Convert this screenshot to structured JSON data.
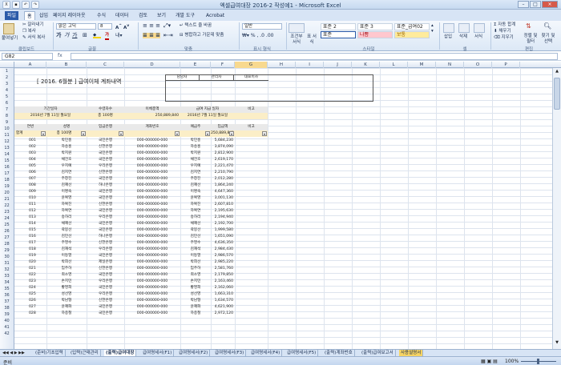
{
  "window": {
    "title": "엑셀급여대장 2016-2 작성예1 - Microsoft Excel",
    "minimize": "–",
    "maximize": "□",
    "close": "×"
  },
  "ribbon_tabs": [
    "파일",
    "홈",
    "삽입",
    "페이지 레이아웃",
    "수식",
    "데이터",
    "검토",
    "보기",
    "개발 도구",
    "Acrobat"
  ],
  "ribbon": {
    "paste": "붙여넣기",
    "cut": "잘라내기",
    "copy": "복사",
    "format_painter": "서식 복사",
    "font_name": "맑은 고딕",
    "font_size": "8",
    "wrap_text": "텍스트 줄 바꿈",
    "merge_center": "병합하고 가운데 맞춤",
    "number_format": "일반",
    "cond_format": "조건부 서식",
    "table_format": "표 서식",
    "styles": [
      "표준 2",
      "표준 3",
      "표준_급여02",
      "표준",
      "나쁨",
      "보통"
    ],
    "insert": "삽입",
    "delete": "삭제",
    "format": "서식",
    "autosum": "자동 합계",
    "fill": "채우기",
    "clear": "지우기",
    "sort_filter": "정렬 및 필터",
    "find_select": "찾기 및 선택",
    "groups": [
      "클립보드",
      "글꼴",
      "맞춤",
      "표시 형식",
      "스타일",
      "셀",
      "편집"
    ]
  },
  "name_box": "G82",
  "fx": "fx",
  "columns": [
    "A",
    "B",
    "C",
    "D",
    "E",
    "F",
    "G",
    "H",
    "I",
    "J",
    "K",
    "L",
    "M",
    "N",
    "O",
    "P"
  ],
  "rows": [
    "1",
    "2",
    "3",
    "4",
    "5",
    "6",
    "7",
    "8",
    "9",
    "10",
    "11",
    "12",
    "13",
    "14",
    "15",
    "16",
    "17",
    "18",
    "19",
    "20",
    "21",
    "22",
    "23",
    "24",
    "25",
    "26",
    "27",
    "28",
    "29",
    "30",
    "31",
    "32",
    "33",
    "34",
    "35",
    "36",
    "37",
    "38",
    "39",
    "40",
    "41",
    "42"
  ],
  "sheet": {
    "title": "[ 2016. 6월분 ] 급여이체 계좌내역",
    "approval": [
      "담당자",
      "관리자",
      "대표이사"
    ],
    "summary_headers": [
      "기간일자",
      "수령자수",
      "이체총액",
      "급여 지급 일자",
      "비고"
    ],
    "summary_values": [
      "2016년 7월 11일 월요일",
      "총 100명",
      "250,889,840",
      "2016년 7월 11일 월요일",
      ""
    ],
    "table_headers": [
      "연번",
      "성명",
      "입금은행",
      "계좌번호",
      "예금주",
      "입금액",
      "비고"
    ],
    "filter_row": [
      "합계",
      "총 100명",
      "",
      "",
      "",
      "250,889,840",
      ""
    ],
    "records": [
      [
        "001",
        "박민홍",
        "국민은행",
        "000-000000-000",
        "박민홍",
        "5,684,230"
      ],
      [
        "002",
        "차송홍",
        "신한은행",
        "000-000000-000",
        "차송홍",
        "3,874,090"
      ],
      [
        "003",
        "박지원",
        "국민은행",
        "000-000000-000",
        "박지원",
        "2,812,900"
      ],
      [
        "004",
        "채건호",
        "국민은행",
        "000-000000-000",
        "채건호",
        "2,619,170"
      ],
      [
        "005",
        "우지예",
        "우리은행",
        "000-000000-000",
        "우지예",
        "2,221,470"
      ],
      [
        "006",
        "김지연",
        "신한은행",
        "000-000000-000",
        "김지연",
        "2,210,790"
      ],
      [
        "007",
        "주창진",
        "국민은행",
        "000-000000-000",
        "주창진",
        "2,012,280"
      ],
      [
        "008",
        "김혜선",
        "하나은행",
        "000-000000-000",
        "김혜선",
        "1,864,240"
      ],
      [
        "009",
        "이명숙",
        "국민은행",
        "000-000000-000",
        "이명숙",
        "4,647,360"
      ],
      [
        "010",
        "윤복영",
        "국민은행",
        "000-000000-000",
        "윤복영",
        "3,001,130"
      ],
      [
        "011",
        "차복진",
        "신한은행",
        "000-000000-000",
        "차복진",
        "2,607,810"
      ],
      [
        "012",
        "차복연",
        "국민은행",
        "000-000000-000",
        "차복연",
        "2,195,630"
      ],
      [
        "013",
        "송하리",
        "우리은행",
        "000-000000-000",
        "송하리",
        "2,194,940"
      ],
      [
        "014",
        "채혜선",
        "국민은행",
        "000-000000-000",
        "채혜선",
        "2,192,700"
      ],
      [
        "015",
        "곽봉선",
        "국민은행",
        "000-000000-000",
        "곽봉선",
        "1,999,580"
      ],
      [
        "016",
        "김민선",
        "하나은행",
        "000-000000-000",
        "김민선",
        "1,651,090"
      ],
      [
        "017",
        "주영수",
        "신한은행",
        "000-000000-000",
        "주영수",
        "4,636,350"
      ],
      [
        "018",
        "김재석",
        "우리은행",
        "000-000000-000",
        "김재석",
        "2,984,430"
      ],
      [
        "019",
        "이동열",
        "국민은행",
        "000-000000-000",
        "이동열",
        "2,986,570"
      ],
      [
        "020",
        "박희선",
        "제일은행",
        "000-000000-000",
        "박희선",
        "2,985,220"
      ],
      [
        "021",
        "임주하",
        "신한은행",
        "000-000000-000",
        "임주하",
        "2,581,760"
      ],
      [
        "022",
        "최소영",
        "국민은행",
        "000-000000-000",
        "최소영",
        "2,179,850"
      ],
      [
        "023",
        "손지민",
        "우리은행",
        "000-000000-000",
        "손지민",
        "2,163,460"
      ],
      [
        "024",
        "황영희",
        "국민은행",
        "000-000000-000",
        "황영희",
        "2,162,060"
      ],
      [
        "025",
        "성선영",
        "우리은행",
        "000-000000-000",
        "성선영",
        "1,663,310"
      ],
      [
        "026",
        "박남형",
        "신한은행",
        "000-000000-000",
        "박남형",
        "1,634,570"
      ],
      [
        "027",
        "윤혜화",
        "국민은행",
        "000-000000-000",
        "윤혜화",
        "4,621,900"
      ],
      [
        "028",
        "하종철",
        "국민은행",
        "000-000000-000",
        "하종철",
        "2,972,120"
      ]
    ]
  },
  "sheet_tabs": [
    "(준비)기초입력",
    "(입력)근태관리",
    "(출력)급여대장",
    "급여명세서(F1)",
    "급여명세서(F2)",
    "급여명세서(F3)",
    "급여명세서(F4)",
    "급여명세서(F5)",
    "(출력)계좌번호",
    "(출력)급여보고서",
    "사용설명서"
  ],
  "active_tab_index": 2,
  "status": {
    "ready": "준비",
    "zoom": "100%"
  }
}
